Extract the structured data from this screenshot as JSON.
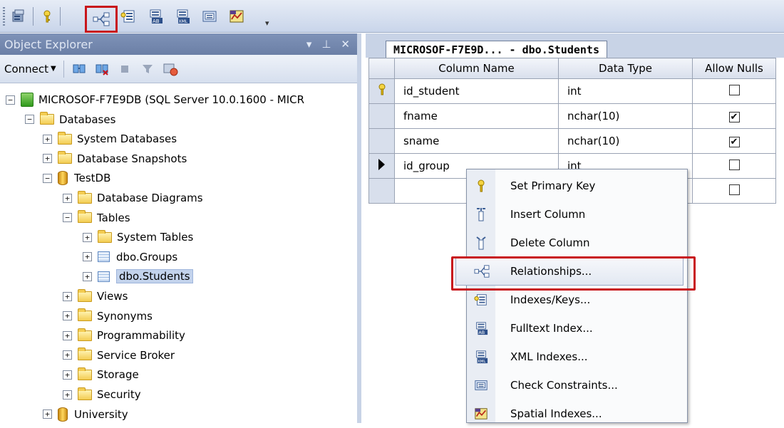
{
  "toolbar": {
    "buttons": [
      {
        "name": "generate-script-icon"
      },
      {
        "name": "primary-key-icon"
      },
      {
        "name": "relationships-icon",
        "highlighted": true
      },
      {
        "name": "indexes-keys-icon"
      },
      {
        "name": "fulltext-index-icon"
      },
      {
        "name": "xml-indexes-icon"
      },
      {
        "name": "check-constraints-icon"
      },
      {
        "name": "spatial-indexes-icon"
      }
    ]
  },
  "object_explorer": {
    "title": "Object Explorer",
    "title_controls": {
      "dropdown": "▾",
      "pin": "⊥",
      "close": "✕"
    },
    "connect_label": "Connect",
    "tree": [
      {
        "label": "MICROSOF-F7E9DB (SQL Server 10.0.1600 - MICR",
        "icon": "server",
        "expander": "−",
        "level": 0
      },
      {
        "label": "Databases",
        "icon": "folder",
        "expander": "−",
        "level": 1
      },
      {
        "label": "System Databases",
        "icon": "folder",
        "expander": "+",
        "level": 2
      },
      {
        "label": "Database Snapshots",
        "icon": "folder",
        "expander": "+",
        "level": 2
      },
      {
        "label": "TestDB",
        "icon": "database",
        "expander": "−",
        "level": 2
      },
      {
        "label": "Database Diagrams",
        "icon": "folder",
        "expander": "+",
        "level": 3
      },
      {
        "label": "Tables",
        "icon": "folder",
        "expander": "−",
        "level": 3
      },
      {
        "label": "System Tables",
        "icon": "folder",
        "expander": "+",
        "level": 4
      },
      {
        "label": "dbo.Groups",
        "icon": "table",
        "expander": "+",
        "level": 4
      },
      {
        "label": "dbo.Students",
        "icon": "table",
        "expander": "+",
        "level": 4,
        "selected": true
      },
      {
        "label": "Views",
        "icon": "folder",
        "expander": "+",
        "level": 3
      },
      {
        "label": "Synonyms",
        "icon": "folder",
        "expander": "+",
        "level": 3
      },
      {
        "label": "Programmability",
        "icon": "folder",
        "expander": "+",
        "level": 3
      },
      {
        "label": "Service Broker",
        "icon": "folder",
        "expander": "+",
        "level": 3
      },
      {
        "label": "Storage",
        "icon": "folder",
        "expander": "+",
        "level": 3
      },
      {
        "label": "Security",
        "icon": "folder",
        "expander": "+",
        "level": 3
      },
      {
        "label": "University",
        "icon": "database",
        "expander": "+",
        "level": 2
      }
    ]
  },
  "document": {
    "tab_label": "MICROSOF-F7E9D... - dbo.Students",
    "columns": {
      "name": "Column Name",
      "type": "Data Type",
      "nulls": "Allow Nulls"
    },
    "rows": [
      {
        "marker": "key",
        "name": "id_student",
        "type": "int",
        "allow_nulls": false
      },
      {
        "marker": "",
        "name": "fname",
        "type": "nchar(10)",
        "allow_nulls": true
      },
      {
        "marker": "",
        "name": "sname",
        "type": "nchar(10)",
        "allow_nulls": true
      },
      {
        "marker": "current",
        "name": "id_group",
        "type": "int",
        "allow_nulls": false
      },
      {
        "marker": "",
        "name": "",
        "type": "",
        "allow_nulls": false
      }
    ]
  },
  "context_menu": {
    "items": [
      {
        "label": "Set Primary Key",
        "icon": "primary-key-icon"
      },
      {
        "label": "Insert Column",
        "icon": "insert-column-icon"
      },
      {
        "label": "Delete Column",
        "icon": "delete-column-icon"
      },
      {
        "label": "Relationships...",
        "icon": "relationships-icon",
        "hover": true
      },
      {
        "label": "Indexes/Keys...",
        "icon": "indexes-keys-icon"
      },
      {
        "label": "Fulltext Index...",
        "icon": "fulltext-index-icon"
      },
      {
        "label": "XML Indexes...",
        "icon": "xml-indexes-icon"
      },
      {
        "label": "Check Constraints...",
        "icon": "check-constraints-icon"
      },
      {
        "label": "Spatial Indexes...",
        "icon": "spatial-indexes-icon"
      }
    ]
  },
  "colors": {
    "highlight_red": "#c8151b",
    "selection": "#c3d3ec",
    "title_bar": "#6b7fa6"
  }
}
